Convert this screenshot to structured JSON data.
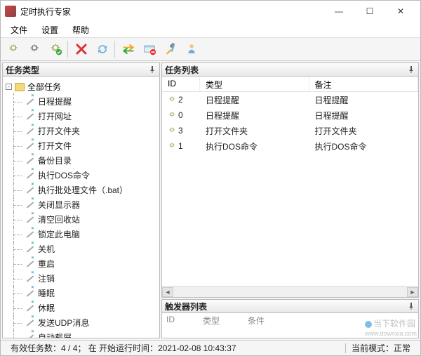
{
  "window": {
    "title": "定时执行专家"
  },
  "menu": {
    "file": "文件",
    "settings": "设置",
    "help": "帮助"
  },
  "panes": {
    "left_title": "任务类型",
    "right_title": "任务列表",
    "trigger_title": "触发器列表"
  },
  "tree": {
    "root": "全部任务",
    "items": [
      "日程提醒",
      "打开网址",
      "打开文件夹",
      "打开文件",
      "备份目录",
      "执行DOS命令",
      "执行批处理文件（.bat）",
      "关闭显示器",
      "清空回收站",
      "锁定此电脑",
      "关机",
      "重启",
      "注销",
      "睡眠",
      "休眠",
      "发送UDP消息",
      "自动截屏"
    ]
  },
  "task_list": {
    "cols": {
      "id": "ID",
      "type": "类型",
      "note": "备注"
    },
    "rows": [
      {
        "id": "2",
        "type": "日程提醒",
        "note": "日程提醒"
      },
      {
        "id": "0",
        "type": "日程提醒",
        "note": "日程提醒"
      },
      {
        "id": "3",
        "type": "打开文件夹",
        "note": "打开文件夹"
      },
      {
        "id": "1",
        "type": "执行DOS命令",
        "note": "执行DOS命令"
      }
    ]
  },
  "trigger_list": {
    "cols": {
      "id": "ID",
      "type": "类型",
      "cond": "条件"
    }
  },
  "status": {
    "count_label": "有效任务数：",
    "count_value": "4 / 4；",
    "start_label": "在 开始运行时间：",
    "start_time": "2021-02-08 10:43:37",
    "mode_label": "当前模式：",
    "mode_value": "正常"
  },
  "watermark": {
    "site": "当下软件园",
    "url": "www.downxia.com"
  }
}
